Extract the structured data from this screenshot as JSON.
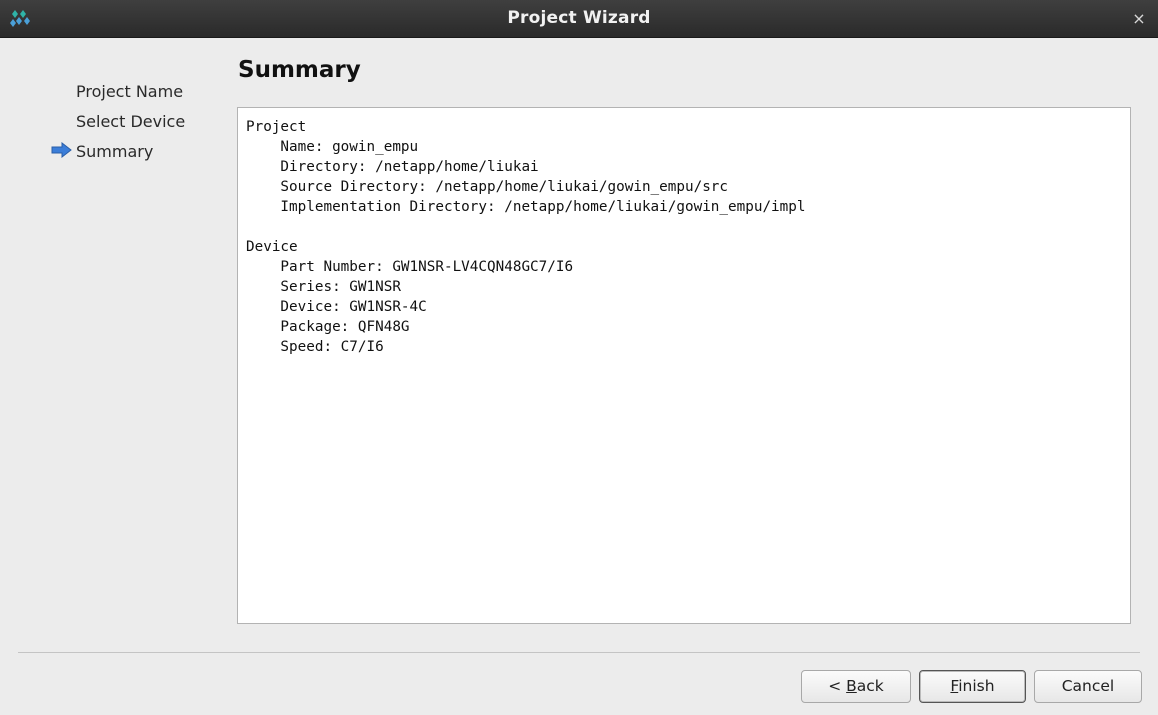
{
  "window": {
    "title": "Project Wizard",
    "close_glyph": "×",
    "app_icon": "gowin-logo-icon",
    "close_icon": "close-icon"
  },
  "nav": {
    "items": [
      {
        "label": "Project Name",
        "active": false
      },
      {
        "label": "Select Device",
        "active": false
      },
      {
        "label": "Summary",
        "active": true
      }
    ],
    "active_marker_icon": "arrow-right-icon",
    "marker_color": "#3b7dd8"
  },
  "page": {
    "heading": "Summary"
  },
  "summary": {
    "lines": [
      "Project",
      "    Name: gowin_empu",
      "    Directory: /netapp/home/liukai",
      "    Source Directory: /netapp/home/liukai/gowin_empu/src",
      "    Implementation Directory: /netapp/home/liukai/gowin_empu/impl",
      "",
      "Device",
      "    Part Number: GW1NSR-LV4CQN48GC7/I6",
      "    Series: GW1NSR",
      "    Device: GW1NSR-4C",
      "    Package: QFN48G",
      "    Speed: C7/I6"
    ]
  },
  "buttons": {
    "back": {
      "prefix": "< ",
      "mnemonic": "B",
      "rest": "ack"
    },
    "finish": {
      "prefix": "",
      "mnemonic": "F",
      "rest": "inish"
    },
    "cancel": {
      "label": "Cancel"
    }
  }
}
